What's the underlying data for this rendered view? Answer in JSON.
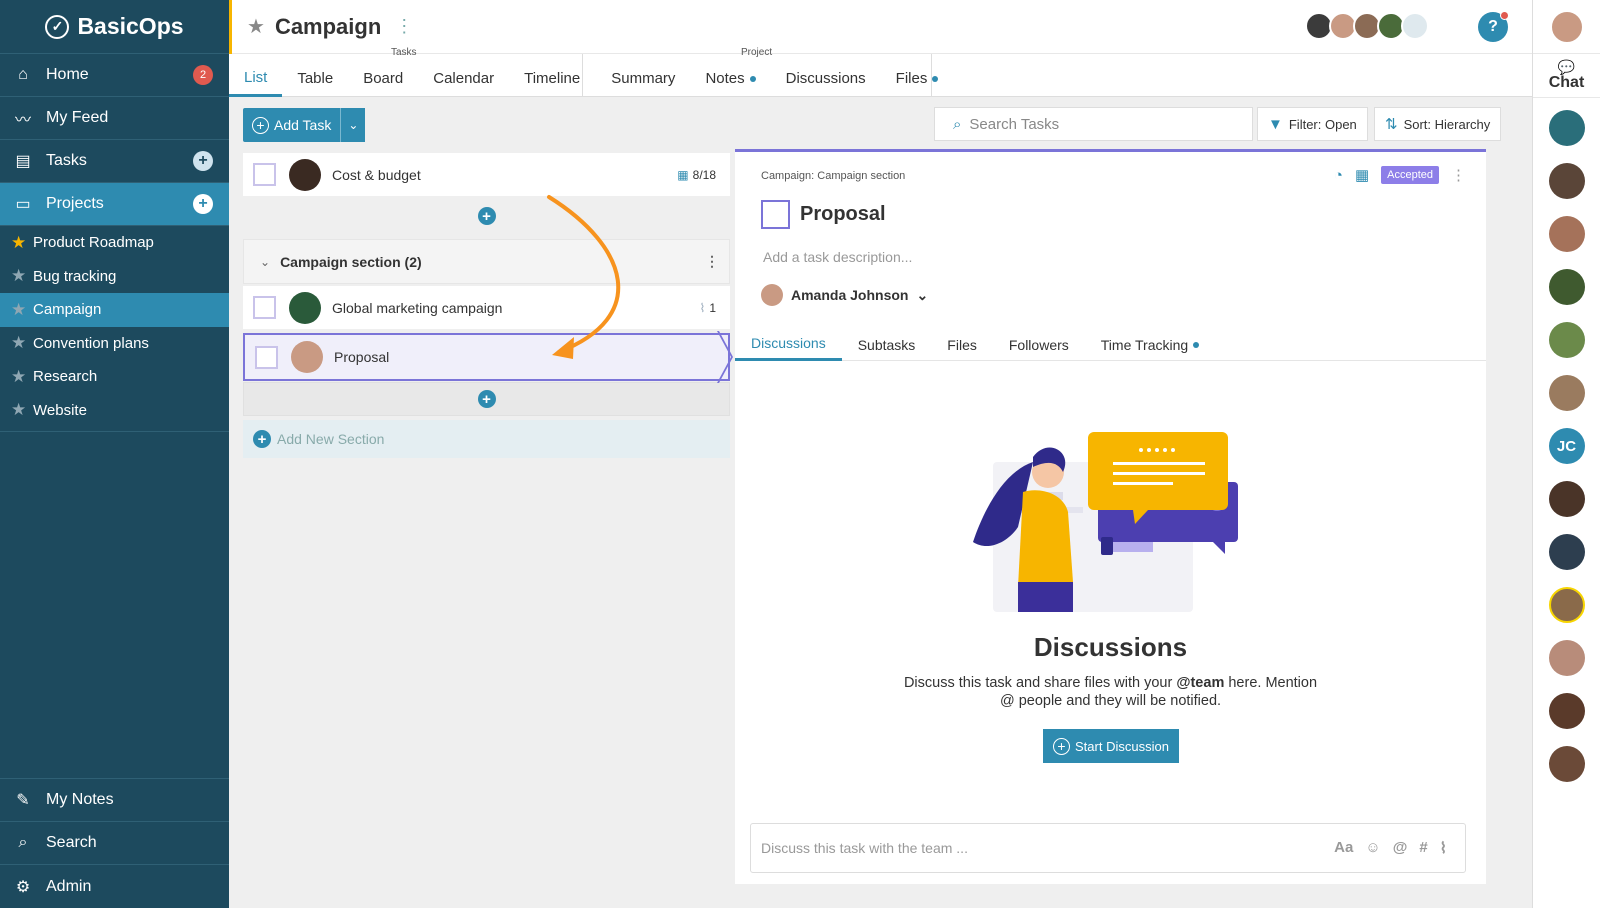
{
  "brand": {
    "name": "BasicOps"
  },
  "sidebar": {
    "nav": [
      {
        "label": "Home",
        "icon": "home-icon",
        "badge": "2"
      },
      {
        "label": "My Feed",
        "icon": "pulse-icon"
      },
      {
        "label": "Tasks",
        "icon": "clipboard-icon"
      },
      {
        "label": "Projects",
        "icon": "folder-icon"
      }
    ],
    "projects": [
      {
        "label": "Product Roadmap",
        "favorite": true
      },
      {
        "label": "Bug tracking",
        "favorite": false
      },
      {
        "label": "Campaign",
        "favorite": false,
        "active": true
      },
      {
        "label": "Convention plans",
        "favorite": false
      },
      {
        "label": "Research",
        "favorite": false
      },
      {
        "label": "Website",
        "favorite": false
      }
    ],
    "bottom": [
      {
        "label": "My Notes",
        "icon": "pencil-icon"
      },
      {
        "label": "Search",
        "icon": "search-icon"
      },
      {
        "label": "Admin",
        "icon": "gear-icon"
      }
    ]
  },
  "header": {
    "title": "Campaign",
    "group_tasks": "Tasks",
    "group_project": "Project",
    "tabs": [
      {
        "label": "List",
        "active": true
      },
      {
        "label": "Table"
      },
      {
        "label": "Board"
      },
      {
        "label": "Calendar"
      },
      {
        "label": "Timeline"
      },
      {
        "label": "Summary"
      },
      {
        "label": "Notes",
        "dot": true
      },
      {
        "label": "Discussions"
      },
      {
        "label": "Files",
        "dot": true
      }
    ]
  },
  "chat": {
    "label": "Chat",
    "initials": "JC"
  },
  "toolbar": {
    "add_task": "Add Task",
    "search_placeholder": "Search Tasks",
    "filter": "Filter: Open",
    "sort": "Sort: Hierarchy"
  },
  "tasks": {
    "top": {
      "name": "Cost & budget",
      "due": "8/18"
    },
    "section": {
      "name": "Campaign section (2)"
    },
    "items": [
      {
        "name": "Global marketing campaign",
        "attachments": "1"
      },
      {
        "name": "Proposal",
        "selected": true
      }
    ],
    "add_section": "Add New Section"
  },
  "detail": {
    "breadcrumb": "Campaign: Campaign section",
    "status": "Accepted",
    "title": "Proposal",
    "description_placeholder": "Add a task description...",
    "assignee": "Amanda Johnson",
    "tabs": [
      {
        "label": "Discussions",
        "active": true
      },
      {
        "label": "Subtasks"
      },
      {
        "label": "Files"
      },
      {
        "label": "Followers"
      },
      {
        "label": "Time Tracking",
        "dot": true
      }
    ],
    "empty_heading": "Discussions",
    "empty_text_1": "Discuss this task and share files with your ",
    "empty_text_team": "@team",
    "empty_text_2": " here. Mention",
    "empty_text_3": "@ people and they will be notified.",
    "start_button": "Start Discussion",
    "composer_placeholder": "Discuss this task with the team ...",
    "composer_format": "Aa"
  },
  "colors": {
    "sidebar": "#1d4a5e",
    "accent": "#2e8bb0",
    "selected": "#7b74d8",
    "arrow": "#f7931e",
    "status": "#8d7ee8"
  }
}
